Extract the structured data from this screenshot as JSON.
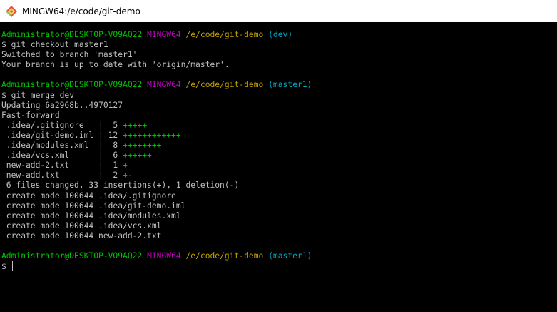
{
  "window": {
    "title": "MINGW64:/e/code/git-demo"
  },
  "colors": {
    "titlebar_bg": "#ffffff",
    "terminal_bg": "#000000",
    "text": "#c0c0c0",
    "user_host": "#00c000",
    "msystem": "#c000c0",
    "path": "#c0a000",
    "branch": "#00a8c0",
    "insertion": "#00c000",
    "deletion": "#d03030"
  },
  "terminal": {
    "lines": [
      {
        "segments": [
          {
            "text": "Administrator@DESKTOP-VO9AQ22",
            "color": "green"
          },
          {
            "text": " ",
            "color": "default"
          },
          {
            "text": "MINGW64",
            "color": "magenta"
          },
          {
            "text": " ",
            "color": "default"
          },
          {
            "text": "/e/code/git-demo",
            "color": "yellow"
          },
          {
            "text": " ",
            "color": "default"
          },
          {
            "text": "(dev)",
            "color": "cyan"
          }
        ]
      },
      {
        "segments": [
          {
            "text": "$ git checkout master1",
            "color": "default"
          }
        ]
      },
      {
        "segments": [
          {
            "text": "Switched to branch 'master1'",
            "color": "default"
          }
        ]
      },
      {
        "segments": [
          {
            "text": "Your branch is up to date with 'origin/master'.",
            "color": "default"
          }
        ]
      },
      {
        "segments": [
          {
            "text": "",
            "color": "default"
          }
        ]
      },
      {
        "segments": [
          {
            "text": "Administrator@DESKTOP-VO9AQ22",
            "color": "green"
          },
          {
            "text": " ",
            "color": "default"
          },
          {
            "text": "MINGW64",
            "color": "magenta"
          },
          {
            "text": " ",
            "color": "default"
          },
          {
            "text": "/e/code/git-demo",
            "color": "yellow"
          },
          {
            "text": " ",
            "color": "default"
          },
          {
            "text": "(master1)",
            "color": "cyan"
          }
        ]
      },
      {
        "segments": [
          {
            "text": "$ git merge dev",
            "color": "default"
          }
        ]
      },
      {
        "segments": [
          {
            "text": "Updating 6a2968b..4970127",
            "color": "default"
          }
        ]
      },
      {
        "segments": [
          {
            "text": "Fast-forward",
            "color": "default"
          }
        ]
      },
      {
        "segments": [
          {
            "text": " .idea/.gitignore   |  5 ",
            "color": "default"
          },
          {
            "text": "+++++",
            "color": "green"
          }
        ]
      },
      {
        "segments": [
          {
            "text": " .idea/git-demo.iml | 12 ",
            "color": "default"
          },
          {
            "text": "++++++++++++",
            "color": "green"
          }
        ]
      },
      {
        "segments": [
          {
            "text": " .idea/modules.xml  |  8 ",
            "color": "default"
          },
          {
            "text": "++++++++",
            "color": "green"
          }
        ]
      },
      {
        "segments": [
          {
            "text": " .idea/vcs.xml      |  6 ",
            "color": "default"
          },
          {
            "text": "++++++",
            "color": "green"
          }
        ]
      },
      {
        "segments": [
          {
            "text": " new-add-2.txt      |  1 ",
            "color": "default"
          },
          {
            "text": "+",
            "color": "green"
          }
        ]
      },
      {
        "segments": [
          {
            "text": " new-add.txt        |  2 ",
            "color": "default"
          },
          {
            "text": "+",
            "color": "green"
          },
          {
            "text": "-",
            "color": "red"
          }
        ]
      },
      {
        "segments": [
          {
            "text": " 6 files changed, 33 insertions(+), 1 deletion(-)",
            "color": "default"
          }
        ]
      },
      {
        "segments": [
          {
            "text": " create mode 100644 .idea/.gitignore",
            "color": "default"
          }
        ]
      },
      {
        "segments": [
          {
            "text": " create mode 100644 .idea/git-demo.iml",
            "color": "default"
          }
        ]
      },
      {
        "segments": [
          {
            "text": " create mode 100644 .idea/modules.xml",
            "color": "default"
          }
        ]
      },
      {
        "segments": [
          {
            "text": " create mode 100644 .idea/vcs.xml",
            "color": "default"
          }
        ]
      },
      {
        "segments": [
          {
            "text": " create mode 100644 new-add-2.txt",
            "color": "default"
          }
        ]
      },
      {
        "segments": [
          {
            "text": "",
            "color": "default"
          }
        ]
      },
      {
        "segments": [
          {
            "text": "Administrator@DESKTOP-VO9AQ22",
            "color": "green"
          },
          {
            "text": " ",
            "color": "default"
          },
          {
            "text": "MINGW64",
            "color": "magenta"
          },
          {
            "text": " ",
            "color": "default"
          },
          {
            "text": "/e/code/git-demo",
            "color": "yellow"
          },
          {
            "text": " ",
            "color": "default"
          },
          {
            "text": "(master1)",
            "color": "cyan"
          }
        ]
      },
      {
        "segments": [
          {
            "text": "$ ",
            "color": "default"
          }
        ],
        "cursor": true
      }
    ]
  }
}
